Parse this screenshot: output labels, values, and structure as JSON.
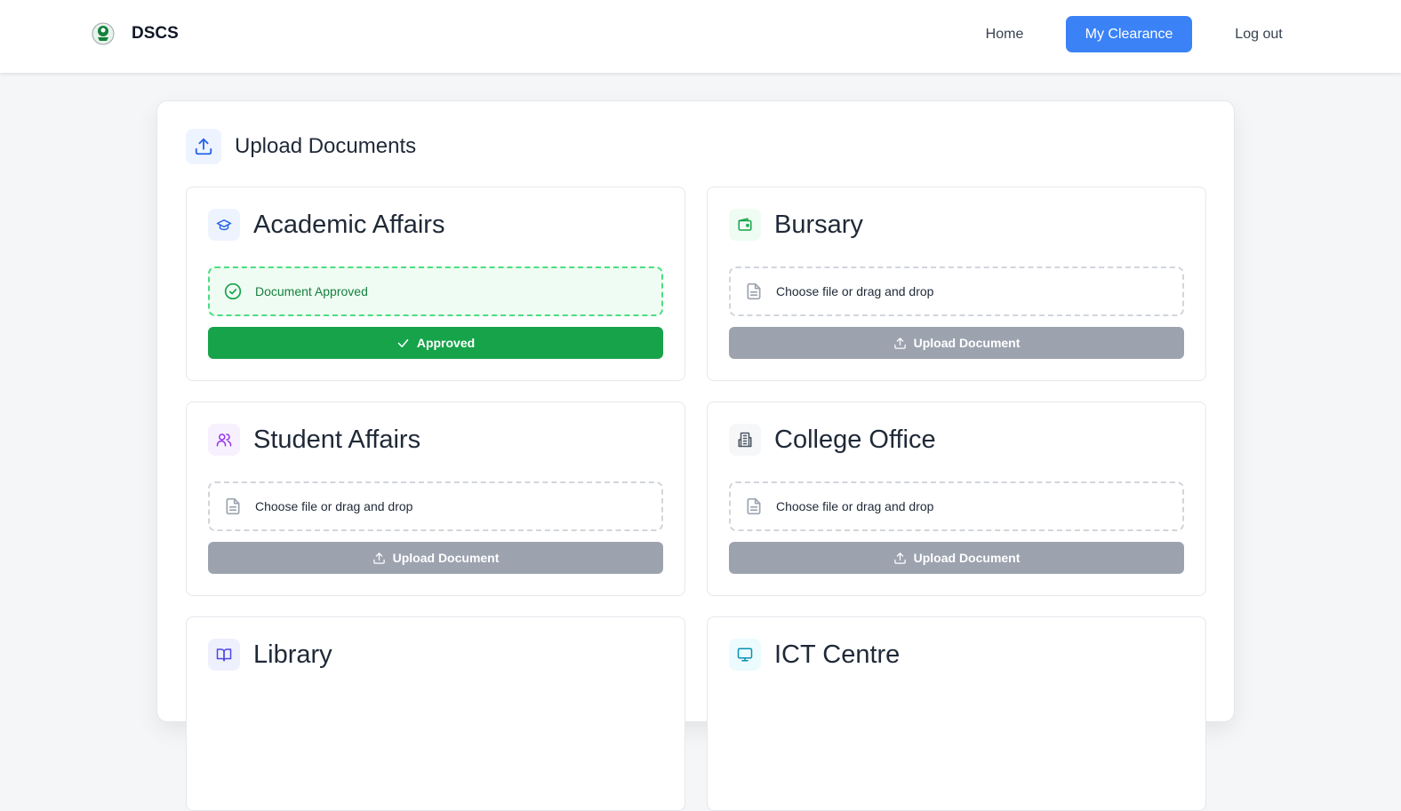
{
  "nav": {
    "brand": "DSCS",
    "links": {
      "home": "Home",
      "clearance": "My Clearance",
      "logout": "Log out"
    }
  },
  "panel": {
    "title": "Upload Documents",
    "icon": "upload-icon"
  },
  "cards": [
    {
      "title": "Academic Affairs",
      "icon": "graduation-cap-icon",
      "icon_color": "#2563eb",
      "icon_bg": "#eef4ff",
      "status_text": "Document Approved",
      "button_label": "Approved",
      "state": "approved"
    },
    {
      "title": "Bursary",
      "icon": "wallet-icon",
      "icon_color": "#16a34a",
      "icon_bg": "#effcf3",
      "status_text": "Choose file or drag and drop",
      "button_label": "Upload Document",
      "state": "pending"
    },
    {
      "title": "Student Affairs",
      "icon": "users-icon",
      "icon_color": "#9333ea",
      "icon_bg": "#f7f0fe",
      "status_text": "Choose file or drag and drop",
      "button_label": "Upload Document",
      "state": "pending"
    },
    {
      "title": "College Office",
      "icon": "building-icon",
      "icon_color": "#4b5563",
      "icon_bg": "#f6f7f9",
      "status_text": "Choose file or drag and drop",
      "button_label": "Upload Document",
      "state": "pending"
    },
    {
      "title": "Library",
      "icon": "book-open-icon",
      "icon_color": "#4f46e5",
      "icon_bg": "#eef0fe",
      "status_text": "",
      "button_label": "",
      "state": "pending"
    },
    {
      "title": "ICT Centre",
      "icon": "monitor-icon",
      "icon_color": "#0891b2",
      "icon_bg": "#ecfbfd",
      "status_text": "",
      "button_label": "",
      "state": "pending"
    }
  ],
  "colors": {
    "primary": "#3b82f6",
    "approved": "#16a34a",
    "disabled": "#9ca3af"
  }
}
